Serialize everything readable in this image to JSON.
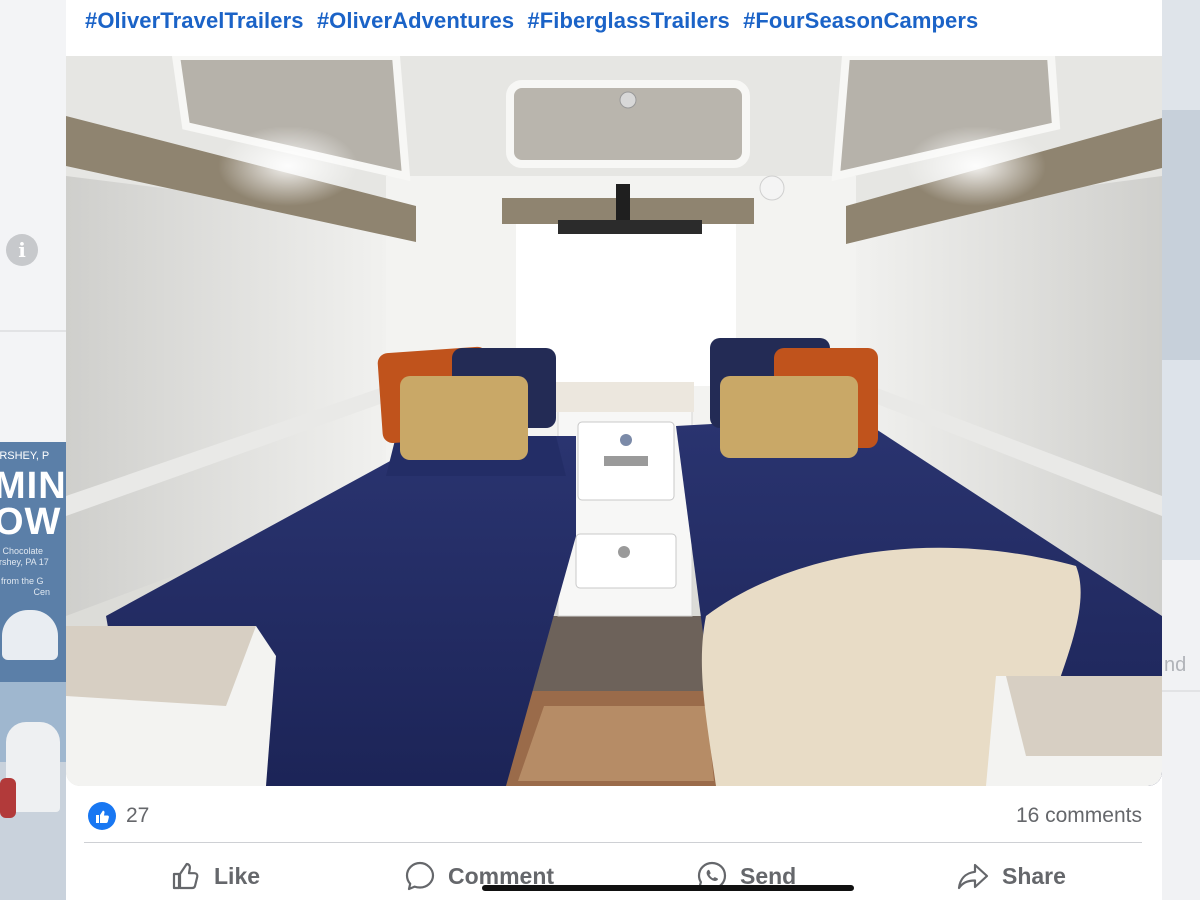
{
  "background": {
    "ad_text_top": "ERSHEY, P",
    "ad_big_1": "MIN",
    "ad_big_2": "OW",
    "ad_small_1": "V Chocolate",
    "ad_small_2": "ershey, PA 17",
    "ad_small_3": "s from the G",
    "ad_small_4": "Cen",
    "right_fragment": "nd"
  },
  "post": {
    "hashtags": [
      "#OliverTravelTrailers",
      "#OliverAdventures",
      "#FiberglassTrailers",
      "#FourSeasonCampers"
    ],
    "image_alt": "Interior of a fiberglass travel trailer with two twin beds with navy comforters"
  },
  "footer": {
    "reaction_count": "27",
    "comments_label": "16 comments"
  },
  "actions": {
    "like": "Like",
    "comment": "Comment",
    "send": "Send",
    "share": "Share"
  },
  "colors": {
    "link": "#1b63c7",
    "like_blue": "#1877f2",
    "meta_text": "#65676b"
  }
}
